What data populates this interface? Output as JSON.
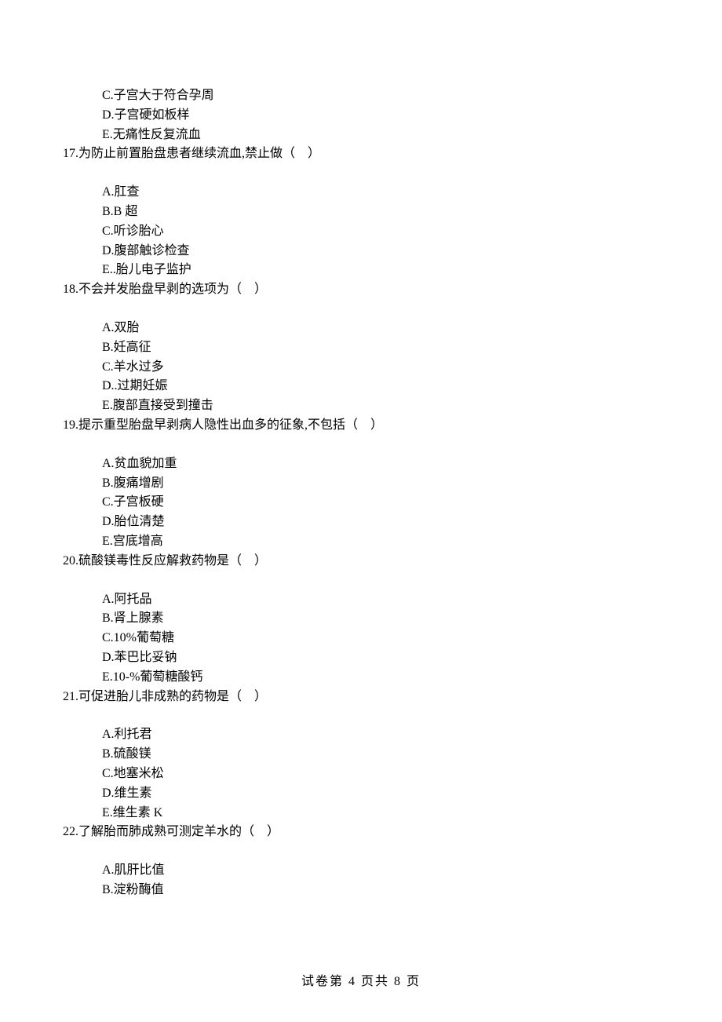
{
  "lines": {
    "opt_c0": "C.子宫大于符合孕周",
    "opt_d0": "D.子宫硬如板样",
    "opt_e0": "E.无痛性反复流血",
    "q17": "17.为防止前置胎盘患者继续流血,禁止做（　）",
    "q17_a": "A.肛查",
    "q17_b": "B.B 超",
    "q17_c": "C.听诊胎心",
    "q17_d": "D.腹部触诊检查",
    "q17_e": "E..胎儿电子监护",
    "q18": "18.不会并发胎盘早剥的选项为（　）",
    "q18_a": "A.双胎",
    "q18_b": "B.妊高征",
    "q18_c": "C.羊水过多",
    "q18_d": "D..过期妊娠",
    "q18_e": "E.腹部直接受到撞击",
    "q19": "19.提示重型胎盘早剥病人隐性出血多的征象,不包括（　）",
    "q19_a": "A.贫血貌加重",
    "q19_b": "B.腹痛增剧",
    "q19_c": "C.子宫板硬",
    "q19_d": "D.胎位清楚",
    "q19_e": "E.宫底增高",
    "q20": "20.硫酸镁毒性反应解救药物是（　）",
    "q20_a": "A.阿托品",
    "q20_b": "B.肾上腺素",
    "q20_c": "C.10%葡萄糖",
    "q20_d": "D.苯巴比妥钠",
    "q20_e": "E.10-%葡萄糖酸钙",
    "q21": "21.可促进胎儿非成熟的药物是（　）",
    "q21_a": "A.利托君",
    "q21_b": "B.硫酸镁",
    "q21_c": "C.地塞米松",
    "q21_d": "D.维生素",
    "q21_e": "E.维生素 K",
    "q22": "22.了解胎而肺成熟可测定羊水的（　）",
    "q22_a": "A.肌肝比值",
    "q22_b": "B.淀粉酶值"
  },
  "footer": "试卷第 4 页共 8 页"
}
